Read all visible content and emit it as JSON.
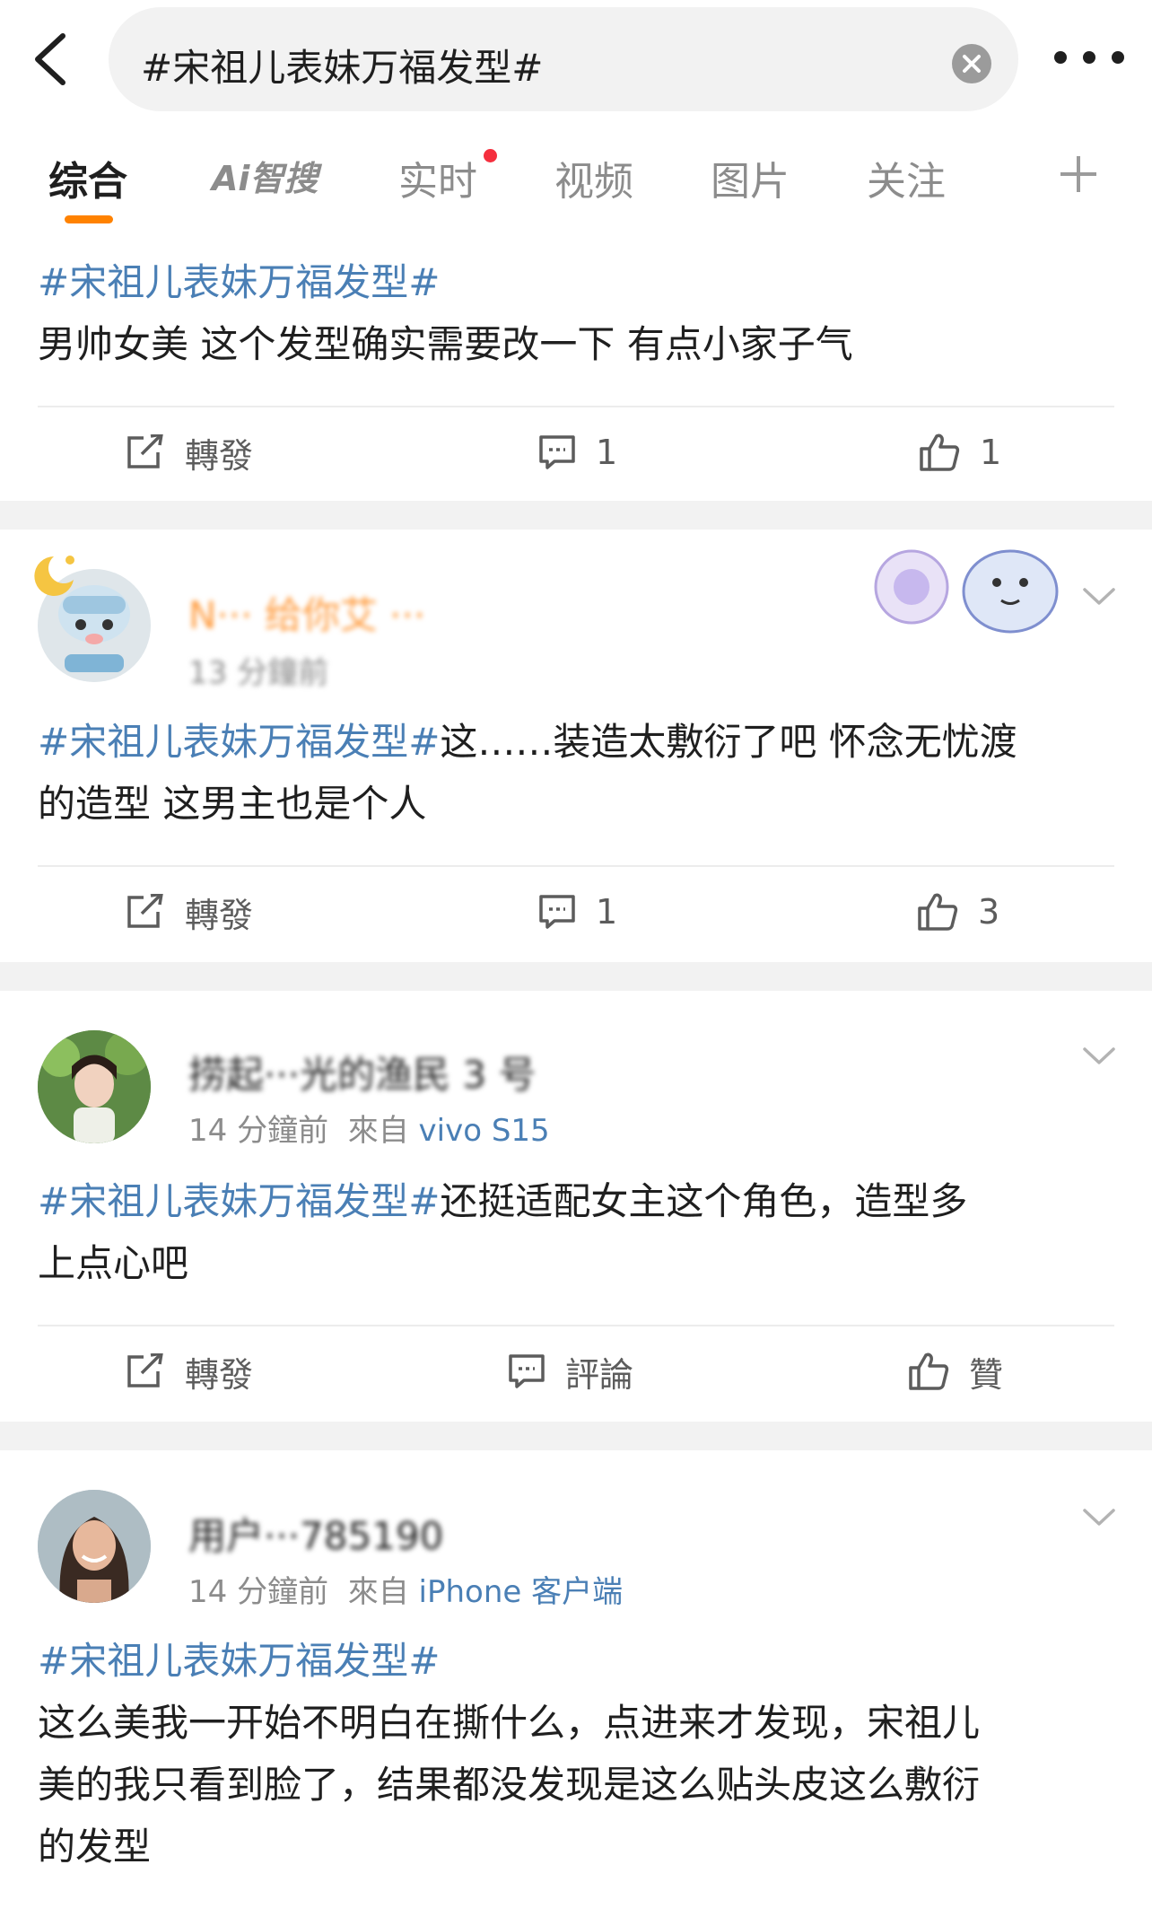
{
  "search": {
    "query": "#宋祖儿表妹万福发型#"
  },
  "tabs": [
    {
      "label": "综合"
    },
    {
      "label": "Ai智搜"
    },
    {
      "label": "实时"
    },
    {
      "label": "视频"
    },
    {
      "label": "图片"
    },
    {
      "label": "关注"
    }
  ],
  "posts": [
    {
      "topic": "#宋祖儿表妹万福发型#",
      "body": "男帅女美 这个发型确实需要改一下 有点小家子气",
      "repost_label": "轉發",
      "comment_count": "1",
      "like_count": "1"
    },
    {
      "username": "N··· 给你艾 ···",
      "time": "13 分鐘前",
      "topic": "#宋祖儿表妹万福发型#",
      "body_line1": "这……装造太敷衍了吧 怀念无忧渡",
      "body_line2": "的造型 这男主也是个人",
      "repost_label": "轉發",
      "comment_count": "1",
      "like_count": "3"
    },
    {
      "username": "捞起···光的渔民 3 号",
      "time": "14 分鐘前",
      "source_prefix": "來自",
      "source": "vivo S15",
      "topic": "#宋祖儿表妹万福发型#",
      "body_line1": "还挺适配女主这个角色，造型多",
      "body_line2": "上点心吧",
      "repost_label": "轉發",
      "comment_label": "評論",
      "like_label": "贊"
    },
    {
      "username": "用户···785190",
      "time": "14 分鐘前",
      "source_prefix": "來自",
      "source": "iPhone 客户端",
      "topic": "#宋祖儿表妹万福发型#",
      "body_line1": "这么美我一开始不明白在撕什么，点进来才发现，宋祖儿",
      "body_line2": "美的我只看到脸了，结果都没发现是这么贴头皮这么敷衍",
      "body_line3": "的发型"
    }
  ],
  "colors": {
    "accent": "#ff8200",
    "topic": "#4a7fb5",
    "badge": "#f52f3e",
    "separator": "#f2f2f2"
  }
}
